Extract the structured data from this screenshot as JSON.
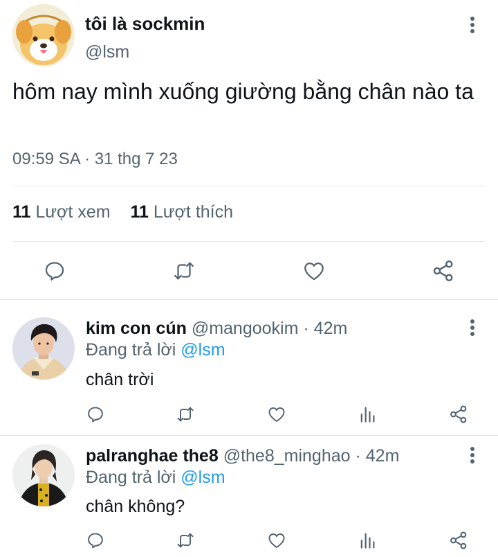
{
  "main_tweet": {
    "author_name": "tôi là sockmin",
    "author_handle": "@lsm",
    "text": "hôm nay mình xuống giường bằng chân nào ta",
    "timestamp": "09:59 SA · 31 thg 7 23",
    "views_count": "11",
    "views_label": "Lượt xem",
    "likes_count": "11",
    "likes_label": "Lượt thích"
  },
  "replies": [
    {
      "name": "kim con cún",
      "handle": "@mangookim",
      "time": "· 42m",
      "replying_prefix": "Đang trả lời",
      "replying_to": "@lsm",
      "text": "chân trời"
    },
    {
      "name": "palranghae the8",
      "handle": "@the8_minghao",
      "time": "· 42m",
      "replying_prefix": "Đang trả lời",
      "replying_to": "@lsm",
      "text": "chân không?"
    }
  ],
  "icons": {
    "reply": "speech-bubble-icon",
    "retweet": "retweet-icon",
    "like": "heart-icon",
    "share": "share-icon",
    "views": "bar-chart-icon",
    "more": "vertical-dots-icon"
  },
  "colors": {
    "text_primary": "#0f1419",
    "text_secondary": "#536471",
    "mention": "#1d9bf0",
    "divider": "#e6e9ec"
  }
}
